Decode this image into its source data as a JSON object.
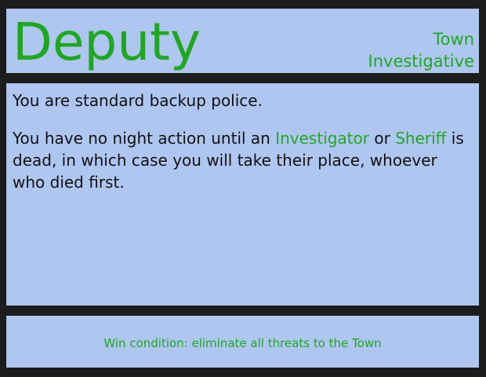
{
  "card": {
    "role": "Deputy",
    "faction": "Town",
    "category": "Investigative",
    "summary": "You are standard backup police.",
    "ability": {
      "t1": "You have no night action until an ",
      "role_a": "Investigator",
      "t2": " or ",
      "role_b": "Sheriff",
      "t3": " is dead, in which case you will take their place, whoever who died first."
    },
    "win_condition": "Win condition: eliminate all threats to the Town"
  },
  "colors": {
    "background": "#1c1c1c",
    "panel": "#aec6f0",
    "accent_green": "#1fa81f",
    "text": "#111111"
  }
}
